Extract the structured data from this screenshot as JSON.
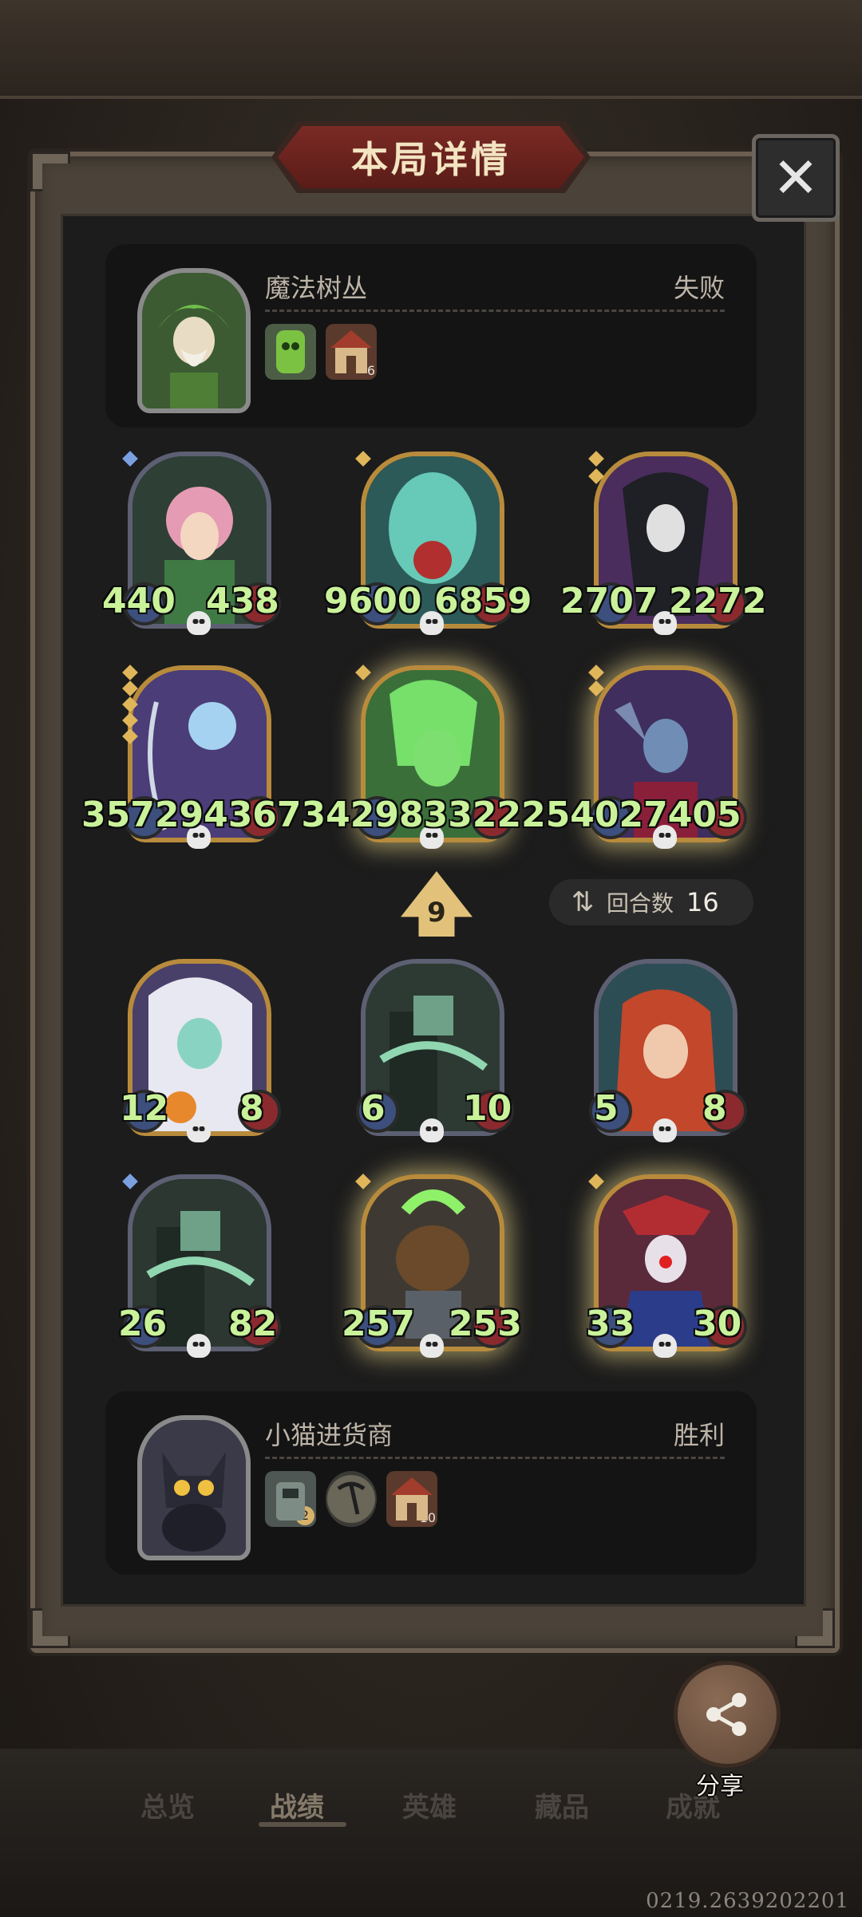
{
  "title": "本局详情",
  "close_label": "✕",
  "top_player": {
    "name": "魔法树丛",
    "result": "失败",
    "icons": [
      {
        "name": "green-totem-icon",
        "count": ""
      },
      {
        "name": "house-icon",
        "count": "6"
      }
    ]
  },
  "bottom_player": {
    "name": "小猫进货商",
    "result": "胜利",
    "icons": [
      {
        "name": "robot-icon",
        "count": "2"
      },
      {
        "name": "pickaxe-icon",
        "count": ""
      },
      {
        "name": "house-icon",
        "count": "10"
      }
    ]
  },
  "enemy_heroes": [
    {
      "atk": "440",
      "hp": "438"
    },
    {
      "atk": "9600",
      "hp": "6859"
    },
    {
      "atk": "2707",
      "hp": "2272"
    },
    {
      "atk": "35729",
      "hp": "43673"
    },
    {
      "atk": "42983",
      "hp": "32225"
    },
    {
      "atk": "40274",
      "hp": "05"
    }
  ],
  "row2_overlap_text": "3572943673429833222540274​05",
  "my_heroes": [
    {
      "atk": "12",
      "hp": "8"
    },
    {
      "atk": "6",
      "hp": "10"
    },
    {
      "atk": "5",
      "hp": "8"
    },
    {
      "atk": "26",
      "hp": "82"
    },
    {
      "atk": "257",
      "hp": "253"
    },
    {
      "atk": "33",
      "hp": "30"
    }
  ],
  "level": "9",
  "rounds_label": "回合数",
  "rounds_value": "16",
  "share_label": "分享",
  "tabs": [
    "总览",
    "战绩",
    "英雄",
    "藏品",
    "成就"
  ],
  "active_tab": "战绩",
  "version": "0219.2639202201",
  "colors": {
    "stat_green": "#c9f29a",
    "panel_bg": "#1c1c1c",
    "title_red": "#7b2a24",
    "gold_frame": "#b88b3c"
  }
}
